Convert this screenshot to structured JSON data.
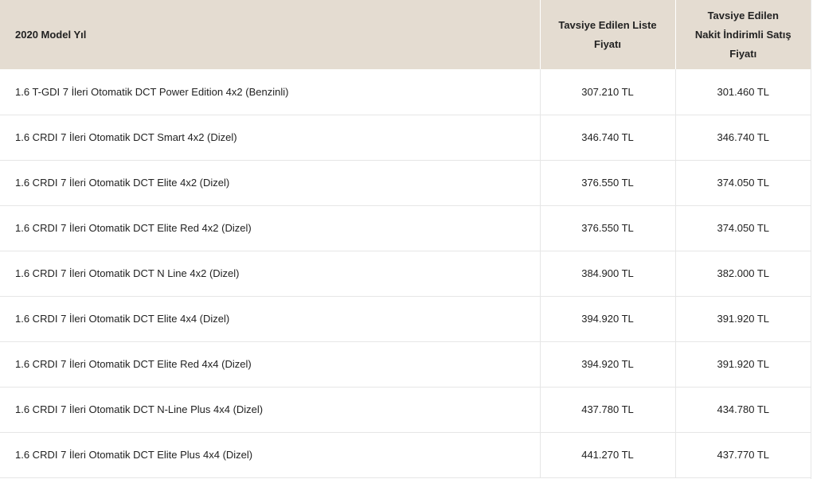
{
  "table": {
    "headers": {
      "model": "2020 Model Yıl",
      "list_price_line1": "Tavsiye Edilen Liste",
      "list_price_line2": "Fiyatı",
      "cash_price_line1": "Tavsiye Edilen",
      "cash_price_line2": "Nakit İndirimli Satış",
      "cash_price_line3": "Fiyatı"
    },
    "rows": [
      {
        "model": "1.6 T-GDI 7 İleri Otomatik DCT Power Edition 4x2 (Benzinli)",
        "list_price": "307.210 TL",
        "cash_price": "301.460 TL"
      },
      {
        "model": "1.6 CRDI 7 İleri Otomatik DCT Smart 4x2 (Dizel)",
        "list_price": "346.740 TL",
        "cash_price": "346.740 TL"
      },
      {
        "model": "1.6 CRDI 7 İleri Otomatik DCT Elite 4x2 (Dizel)",
        "list_price": "376.550 TL",
        "cash_price": "374.050 TL"
      },
      {
        "model": "1.6 CRDI 7 İleri Otomatik DCT Elite Red 4x2 (Dizel)",
        "list_price": "376.550 TL",
        "cash_price": "374.050 TL"
      },
      {
        "model": "1.6 CRDI 7 İleri Otomatik DCT N Line 4x2 (Dizel)",
        "list_price": "384.900 TL",
        "cash_price": "382.000 TL"
      },
      {
        "model": "1.6 CRDI 7 İleri Otomatik DCT Elite 4x4 (Dizel)",
        "list_price": "394.920 TL",
        "cash_price": "391.920 TL"
      },
      {
        "model": "1.6 CRDI 7 İleri Otomatik DCT Elite Red 4x4 (Dizel)",
        "list_price": "394.920 TL",
        "cash_price": "391.920 TL"
      },
      {
        "model": "1.6 CRDI 7 İleri Otomatik DCT N-Line Plus 4x4 (Dizel)",
        "list_price": "437.780 TL",
        "cash_price": "434.780 TL"
      },
      {
        "model": "1.6 CRDI 7 İleri Otomatik DCT Elite Plus 4x4 (Dizel)",
        "list_price": "441.270 TL",
        "cash_price": "437.770 TL"
      }
    ]
  },
  "colors": {
    "header_background": "#e4dcd1",
    "text": "#222222",
    "row_border": "#e6e6e6"
  }
}
